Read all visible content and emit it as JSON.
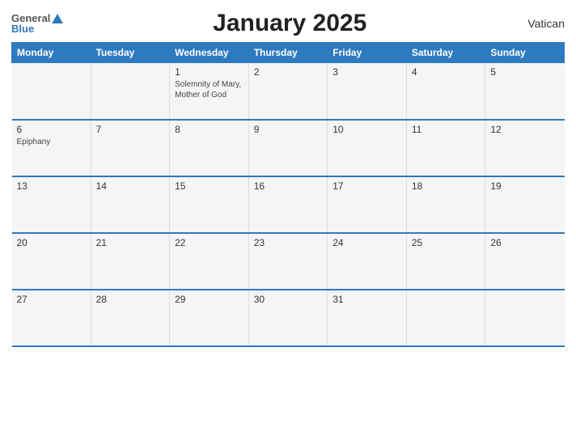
{
  "header": {
    "title": "January 2025",
    "country": "Vatican",
    "logo_general": "General",
    "logo_blue": "Blue"
  },
  "weekdays": [
    "Monday",
    "Tuesday",
    "Wednesday",
    "Thursday",
    "Friday",
    "Saturday",
    "Sunday"
  ],
  "weeks": [
    [
      {
        "day": "",
        "event": ""
      },
      {
        "day": "",
        "event": ""
      },
      {
        "day": "1",
        "event": "Solemnity of Mary, Mother of God"
      },
      {
        "day": "2",
        "event": ""
      },
      {
        "day": "3",
        "event": ""
      },
      {
        "day": "4",
        "event": ""
      },
      {
        "day": "5",
        "event": ""
      }
    ],
    [
      {
        "day": "6",
        "event": "Epiphany"
      },
      {
        "day": "7",
        "event": ""
      },
      {
        "day": "8",
        "event": ""
      },
      {
        "day": "9",
        "event": ""
      },
      {
        "day": "10",
        "event": ""
      },
      {
        "day": "11",
        "event": ""
      },
      {
        "day": "12",
        "event": ""
      }
    ],
    [
      {
        "day": "13",
        "event": ""
      },
      {
        "day": "14",
        "event": ""
      },
      {
        "day": "15",
        "event": ""
      },
      {
        "day": "16",
        "event": ""
      },
      {
        "day": "17",
        "event": ""
      },
      {
        "day": "18",
        "event": ""
      },
      {
        "day": "19",
        "event": ""
      }
    ],
    [
      {
        "day": "20",
        "event": ""
      },
      {
        "day": "21",
        "event": ""
      },
      {
        "day": "22",
        "event": ""
      },
      {
        "day": "23",
        "event": ""
      },
      {
        "day": "24",
        "event": ""
      },
      {
        "day": "25",
        "event": ""
      },
      {
        "day": "26",
        "event": ""
      }
    ],
    [
      {
        "day": "27",
        "event": ""
      },
      {
        "day": "28",
        "event": ""
      },
      {
        "day": "29",
        "event": ""
      },
      {
        "day": "30",
        "event": ""
      },
      {
        "day": "31",
        "event": ""
      },
      {
        "day": "",
        "event": ""
      },
      {
        "day": "",
        "event": ""
      }
    ]
  ]
}
